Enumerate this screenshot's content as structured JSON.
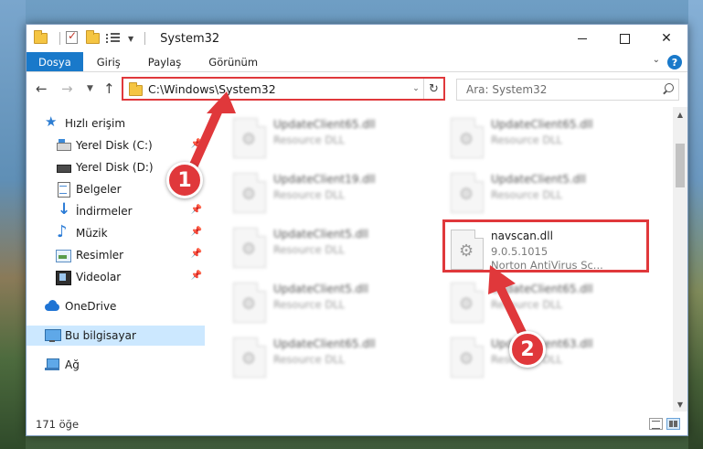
{
  "window": {
    "title": "System32"
  },
  "ribbon": {
    "tabs": [
      "Dosya",
      "Giriş",
      "Paylaş",
      "Görünüm"
    ]
  },
  "address": {
    "path": "C:\\Windows\\System32",
    "search_placeholder": "Ara: System32"
  },
  "sidebar": {
    "items": [
      {
        "label": "Hızlı erişim",
        "icon": "star-icon"
      },
      {
        "label": "Yerel Disk (C:)",
        "icon": "disk-icon"
      },
      {
        "label": "Yerel Disk (D:)",
        "icon": "disk-icon"
      },
      {
        "label": "Belgeler",
        "icon": "document-icon"
      },
      {
        "label": "İndirmeler",
        "icon": "download-icon"
      },
      {
        "label": "Müzik",
        "icon": "music-icon"
      },
      {
        "label": "Resimler",
        "icon": "pictures-icon"
      },
      {
        "label": "Videolar",
        "icon": "video-icon"
      },
      {
        "label": "OneDrive",
        "icon": "cloud-icon"
      },
      {
        "label": "Bu bilgisayar",
        "icon": "computer-icon"
      },
      {
        "label": "Ağ",
        "icon": "network-icon"
      }
    ]
  },
  "files": [
    {
      "name": "UpdateClient65.dll",
      "desc": "Resource DLL"
    },
    {
      "name": "UpdateClient65.dll",
      "desc": "Resource DLL"
    },
    {
      "name": "UpdateClient19.dll",
      "desc": "Resource DLL"
    },
    {
      "name": "UpdateClient5.dll",
      "desc": "Resource DLL"
    },
    {
      "name": "UpdateClient5.dll",
      "desc": "Resource DLL"
    },
    {
      "name": "navscan.dll",
      "version": "9.0.5.1015",
      "desc": "Norton AntiVirus Sc..."
    },
    {
      "name": "UpdateClient5.dll",
      "desc": "Resource DLL"
    },
    {
      "name": "UpdateClient65.dll",
      "desc": "Resource DLL"
    },
    {
      "name": "UpdateClient65.dll",
      "desc": "Resource DLL"
    },
    {
      "name": "UpdateClient63.dll",
      "desc": "Resource DLL"
    }
  ],
  "status": {
    "count": "171 öğe"
  },
  "annotations": {
    "badge1": "1",
    "badge2": "2",
    "color": "#e0383b"
  }
}
